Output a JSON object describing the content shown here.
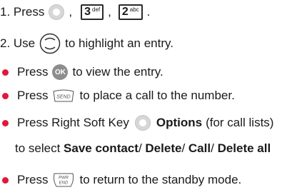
{
  "step1": {
    "prefix": "1. Press",
    "comma1": ",",
    "comma2": ",",
    "key3_digit": "3",
    "key3_sub": "def",
    "key2_digit": "2",
    "key2_sub": "abc",
    "end": "."
  },
  "step2": {
    "prefix": "2.  Use",
    "suffix": "to highlight an entry."
  },
  "bullets": {
    "b1": {
      "pre": "Press",
      "ok": "OK",
      "post": "to view the entry."
    },
    "b2": {
      "pre": "Press",
      "send": "SEND",
      "post": "to place a call to the number."
    },
    "b3": {
      "pre": "Press Right Soft Key",
      "options": "Options",
      "post": "(for call lists)"
    },
    "b3_line2": {
      "pre": "to select",
      "save": "Save contact",
      "s1": "/",
      "delete": "Delete",
      "s2": "/",
      "call": "Call",
      "s3": "/",
      "delete_all": "Delete all"
    },
    "b4": {
      "pre": "Press",
      "end_top": "PWR",
      "end_bottom": "END",
      "post": "to return to the standby mode."
    }
  },
  "colors": {
    "bullet": "#e3173c",
    "key_fill": "#d7d7d7",
    "ok_fill": "#8d8d8d"
  },
  "icons": [
    "menu-key-icon",
    "key-3-icon",
    "key-2-icon",
    "navigation-key-icon",
    "ok-key-icon",
    "send-key-icon",
    "soft-key-icon",
    "end-key-icon"
  ]
}
